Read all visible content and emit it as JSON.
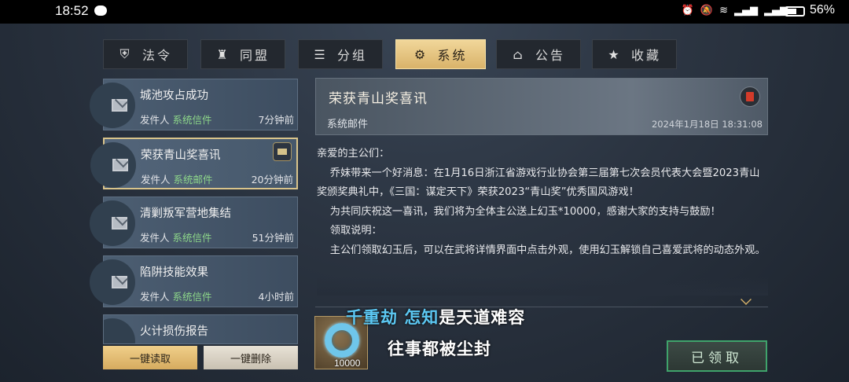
{
  "status_bar": {
    "time": "18:52",
    "battery": "56%",
    "icons": [
      "wechat-icon",
      "alarm-icon",
      "mute-icon",
      "wifi-icon",
      "signal-icon",
      "signal-icon",
      "battery-icon"
    ]
  },
  "tabs": [
    {
      "label": "法令",
      "icon": "badge-icon"
    },
    {
      "label": "同盟",
      "icon": "alliance-icon"
    },
    {
      "label": "分组",
      "icon": "list-icon"
    },
    {
      "label": "系统",
      "icon": "gear-icon",
      "active": true
    },
    {
      "label": "公告",
      "icon": "notice-icon"
    },
    {
      "label": "收藏",
      "icon": "star-icon"
    }
  ],
  "mail_list": [
    {
      "title": "城池攻占成功",
      "sender_prefix": "发件人",
      "sender": "系统信件",
      "time": "7分钟前"
    },
    {
      "title": "荣获青山奖喜讯",
      "sender_prefix": "发件人",
      "sender": "系统邮件",
      "time": "20分钟前",
      "selected": true,
      "has_attachment": true
    },
    {
      "title": "清剿叛军营地集结",
      "sender_prefix": "发件人",
      "sender": "系统信件",
      "time": "51分钟前"
    },
    {
      "title": "陷阱技能效果",
      "sender_prefix": "发件人",
      "sender": "系统信件",
      "time": "4小时前"
    },
    {
      "title": "火计损伤报告",
      "sender_prefix": "",
      "sender": "",
      "time": ""
    }
  ],
  "actions": {
    "read_all": "一键读取",
    "delete_all": "一键删除"
  },
  "detail": {
    "title": "荣获青山奖喜讯",
    "subtitle": "系统邮件",
    "date": "2024年1月18日 18:31:08",
    "paragraphs": [
      "亲爱的主公们：",
      "    乔妹带来一个好消息：在1月16日浙江省游戏行业协会第三届第七次会员代表大会暨2023青山奖颁奖典礼中，《三国：谋定天下》荣获2023“青山奖”优秀国风游戏！",
      "",
      "    为共同庆祝这一喜讯，我们将为全体主公送上幻玉*10000，感谢大家的支持与鼓励！",
      "",
      "    领取说明：",
      "    主公们领取幻玉后，可以在武将详情界面中点击外观，使用幻玉解锁自己喜爱武将的动态外观。"
    ],
    "reward": {
      "count": "10000",
      "icon": "jade-ring-icon"
    },
    "claim_label": "已领取"
  },
  "subtitles": {
    "line1_highlight": "千重劫 怎知",
    "line1_rest": "是天道难容",
    "line2": "往事都被尘封"
  },
  "colors": {
    "tab_active": "#e6c47f",
    "sender_green": "#8ed88a",
    "claim_border": "#3fa36b",
    "caption_highlight": "#5cc8f3"
  }
}
